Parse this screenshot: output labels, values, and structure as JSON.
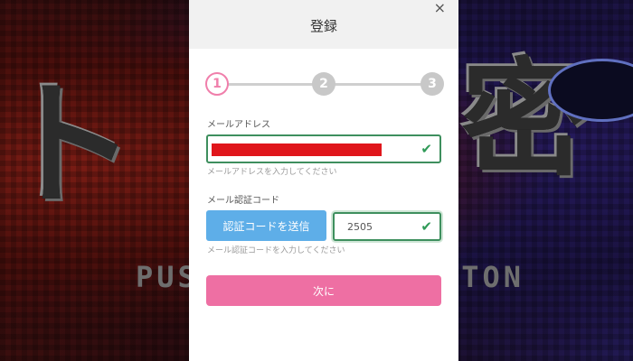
{
  "modal": {
    "title": "登録",
    "close_label": "×"
  },
  "stepper": {
    "steps": [
      "1",
      "2",
      "3"
    ],
    "active_step": 1,
    "active_color": "#f07fab",
    "inactive_color": "#c8c8c8"
  },
  "email": {
    "label": "メールアドレス",
    "value_redacted": true,
    "hint": "メールアドレスを入力してください",
    "valid_icon": "check-icon"
  },
  "code": {
    "label": "メール認証コード",
    "send_button_label": "認証コードを送信",
    "value": "2505",
    "hint": "メール認証コードを入力してください",
    "valid_icon": "check-icon"
  },
  "next_button_label": "次に",
  "background": {
    "caption_left": "PUS",
    "caption_right": "TON"
  },
  "colors": {
    "accent_pink": "#ee6fa3",
    "button_blue": "#5eaee8",
    "valid_green": "#3e8f5e",
    "redaction_red": "#e0161c"
  }
}
